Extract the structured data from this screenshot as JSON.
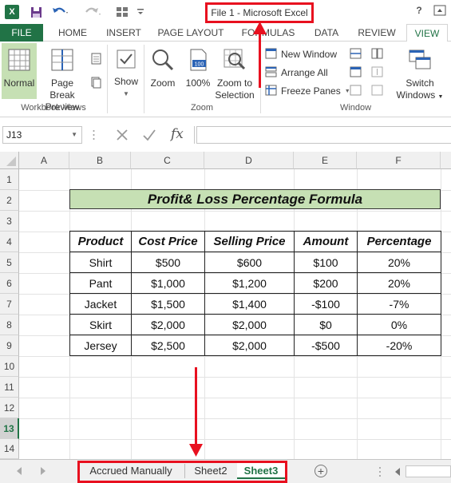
{
  "titlebar": {
    "title": "File 1 - Microsoft Excel",
    "help": "?",
    "logo": "X"
  },
  "tabs": [
    "FILE",
    "HOME",
    "INSERT",
    "PAGE LAYOUT",
    "FORMULAS",
    "DATA",
    "REVIEW",
    "VIEW"
  ],
  "ribbon": {
    "workbook_views": {
      "label": "Workbook Views",
      "normal": "Normal",
      "page_break_1": "Page Break",
      "page_break_2": "Preview"
    },
    "show": {
      "label": "Show"
    },
    "zoom": {
      "label": "Zoom",
      "zoom": "Zoom",
      "hundred": "100%",
      "zoom_sel_1": "Zoom to",
      "zoom_sel_2": "Selection"
    },
    "window": {
      "label": "Window",
      "new_window": "New Window",
      "arrange_all": "Arrange All",
      "freeze_panes": "Freeze Panes",
      "switch_1": "Switch",
      "switch_2": "Windows"
    }
  },
  "formula_bar": {
    "name_box": "J13",
    "fx": "fx",
    "content": ""
  },
  "columns": [
    "A",
    "B",
    "C",
    "D",
    "E",
    "F"
  ],
  "rows": [
    "1",
    "2",
    "3",
    "4",
    "5",
    "6",
    "7",
    "8",
    "9",
    "10",
    "11",
    "12",
    "13",
    "14"
  ],
  "sheet": {
    "title": "Profit& Loss Percentage Formula",
    "headers": [
      "Product",
      "Cost Price",
      "Selling Price",
      "Amount",
      "Percentage"
    ],
    "rows": [
      [
        "Shirt",
        "$500",
        "$600",
        "$100",
        "20%"
      ],
      [
        "Pant",
        "$1,000",
        "$1,200",
        "$200",
        "20%"
      ],
      [
        "Jacket",
        "$1,500",
        "$1,400",
        "-$100",
        "-7%"
      ],
      [
        "Skirt",
        "$2,000",
        "$2,000",
        "$0",
        "0%"
      ],
      [
        "Jersey",
        "$2,500",
        "$2,000",
        "-$500",
        "-20%"
      ]
    ]
  },
  "sheet_tabs": {
    "tab1": "Accrued Manually",
    "tab2": "Sheet2",
    "tab3": "Sheet3",
    "add": "+"
  },
  "colors": {
    "excel_green": "#217346",
    "title_fill": "#c6e0b4",
    "highlight_red": "#e8101f"
  }
}
